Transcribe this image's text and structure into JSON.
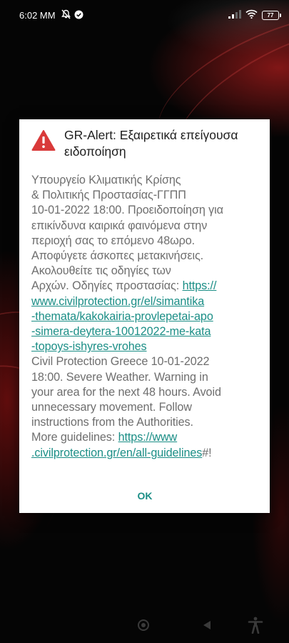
{
  "status_bar": {
    "time": "6:02 MM",
    "battery": "77",
    "icons": [
      "notifications-off-icon",
      "check-circle-icon",
      "signal-icon",
      "wifi-icon",
      "battery-icon"
    ]
  },
  "dialog": {
    "title_line1": "GR-Alert: Εξαιρετικά επείγουσα",
    "title_line2": "ειδοποίηση",
    "body_lines": [
      "Υπουργείο Κλιματικής Κρίσης",
      "& Πολιτικής Προστασίας-ΓΓΠΠ",
      "10-01-2022 18:00. Προειδοποίηση για",
      "επικίνδυνα καιρικά φαινόμενα στην",
      "περιοχή σας το επόμενο 48ωρο.",
      "Αποφύγετε άσκοπες μετακινήσεις.",
      "Ακολουθείτε τις οδηγίες των",
      "Αρχών. Οδηγίες προστασίας:"
    ],
    "link_gr_first": "https://",
    "link_gr_lines": [
      "www.civilprotection.gr/el/simantika",
      "-themata/kakokairia-provlepetai-apo",
      "-simera-deytera-10012022-me-kata",
      "-topoys-ishyres-vrohes"
    ],
    "body_en_lines": [
      "Civil Protection Greece 10-01-2022",
      "18:00. Severe Weather. Warning in",
      "your area for the next 48 hours. Avoid",
      "unnecessary movement. Follow",
      "instructions from the Authorities."
    ],
    "en_guidelines_prefix": "More guidelines:",
    "link_en_first": "https://www",
    "link_en_second": ".civilprotection.gr/en/all-guidelines",
    "trailing": "#!",
    "ok_label": "OK"
  },
  "colors": {
    "accent": "#1b8e86",
    "warning": "#d93a3a"
  },
  "nav_bar": {
    "icons": [
      "home-icon",
      "back-icon",
      "accessibility-icon"
    ]
  }
}
